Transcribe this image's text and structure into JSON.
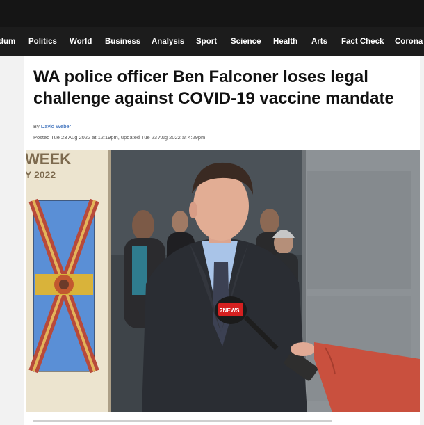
{
  "nav": {
    "items": [
      "dum",
      "Politics",
      "World",
      "Business",
      "Analysis",
      "Sport",
      "Science",
      "Health",
      "Arts",
      "Fact Check",
      "Corona"
    ]
  },
  "article": {
    "headline": "WA police officer Ben Falconer loses legal challenge against COVID-19 vaccine mandate",
    "byline_prefix": "By",
    "author": "David Weber",
    "dates": "Posted Tue 23 Aug 2022 at 12:19pm, updated Tue 23 Aug 2022 at 4:29pm"
  },
  "photo": {
    "poster_text_1": "WEEK",
    "poster_text_2": "Y 2022",
    "mic_brand": "7NEWS"
  },
  "colors": {
    "topbar": "#151515",
    "navbar": "#1c1c1c",
    "link": "#1a57b0",
    "jacket": "#2a2d33",
    "shirt": "#a9c4e8",
    "sleeve": "#c9503e"
  }
}
